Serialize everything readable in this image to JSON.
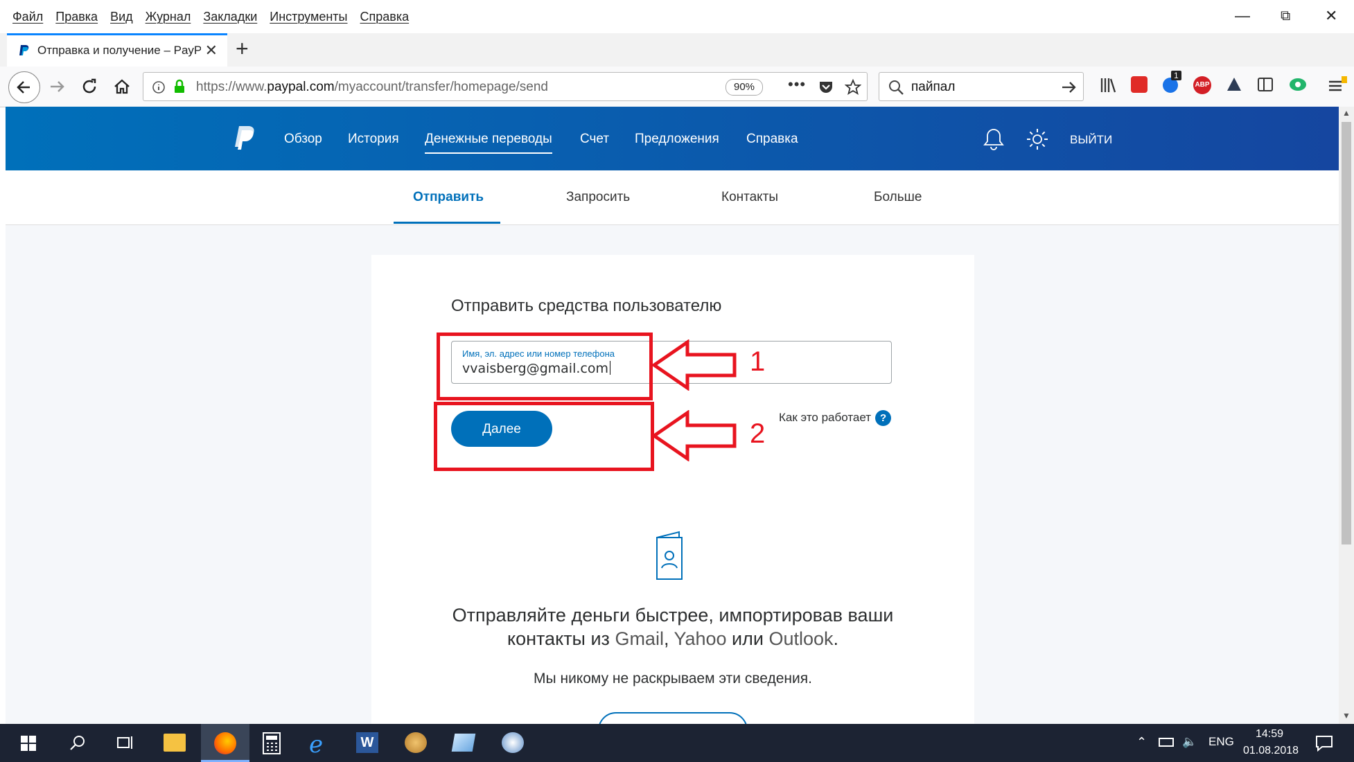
{
  "menubar": {
    "items": [
      "Файл",
      "Правка",
      "Вид",
      "Журнал",
      "Закладки",
      "Инструменты",
      "Справка"
    ]
  },
  "tab": {
    "title": "Отправка и получение – PayP"
  },
  "address": {
    "prefix": "https://www.",
    "domain": "paypal.com",
    "path": "/myaccount/transfer/homepage/send",
    "zoom": "90%"
  },
  "search": {
    "query": "пайпал"
  },
  "extension_badge": "1",
  "paypal_nav": {
    "items": [
      "Обзор",
      "История",
      "Денежные переводы",
      "Счет",
      "Предложения",
      "Справка"
    ],
    "logout": "ВЫЙТИ"
  },
  "subnav": {
    "items": [
      "Отправить",
      "Запросить",
      "Контакты",
      "Больше"
    ]
  },
  "form": {
    "title": "Отправить средства пользователю",
    "field_label": "Имя, эл. адрес или номер телефона",
    "field_value": "vvaisberg@gmail.com",
    "next_button": "Далее",
    "how_it_works": "Как это работает",
    "help": "?"
  },
  "promo": {
    "line1": "Отправляйте деньги быстрее, импортировав ваши",
    "line2_a": "контакты из ",
    "gmail": "Gmail",
    "sep1": ", ",
    "yahoo": "Yahoo",
    "or": " или ",
    "outlook": "Outlook",
    "end": ".",
    "privacy": "Мы никому не раскрываем эти сведения."
  },
  "annotations": {
    "one": "1",
    "two": "2"
  },
  "taskbar": {
    "lang": "ENG",
    "time": "14:59",
    "date": "01.08.2018"
  },
  "colors": {
    "paypal_blue": "#0070ba",
    "annotation_red": "#e8141f"
  }
}
